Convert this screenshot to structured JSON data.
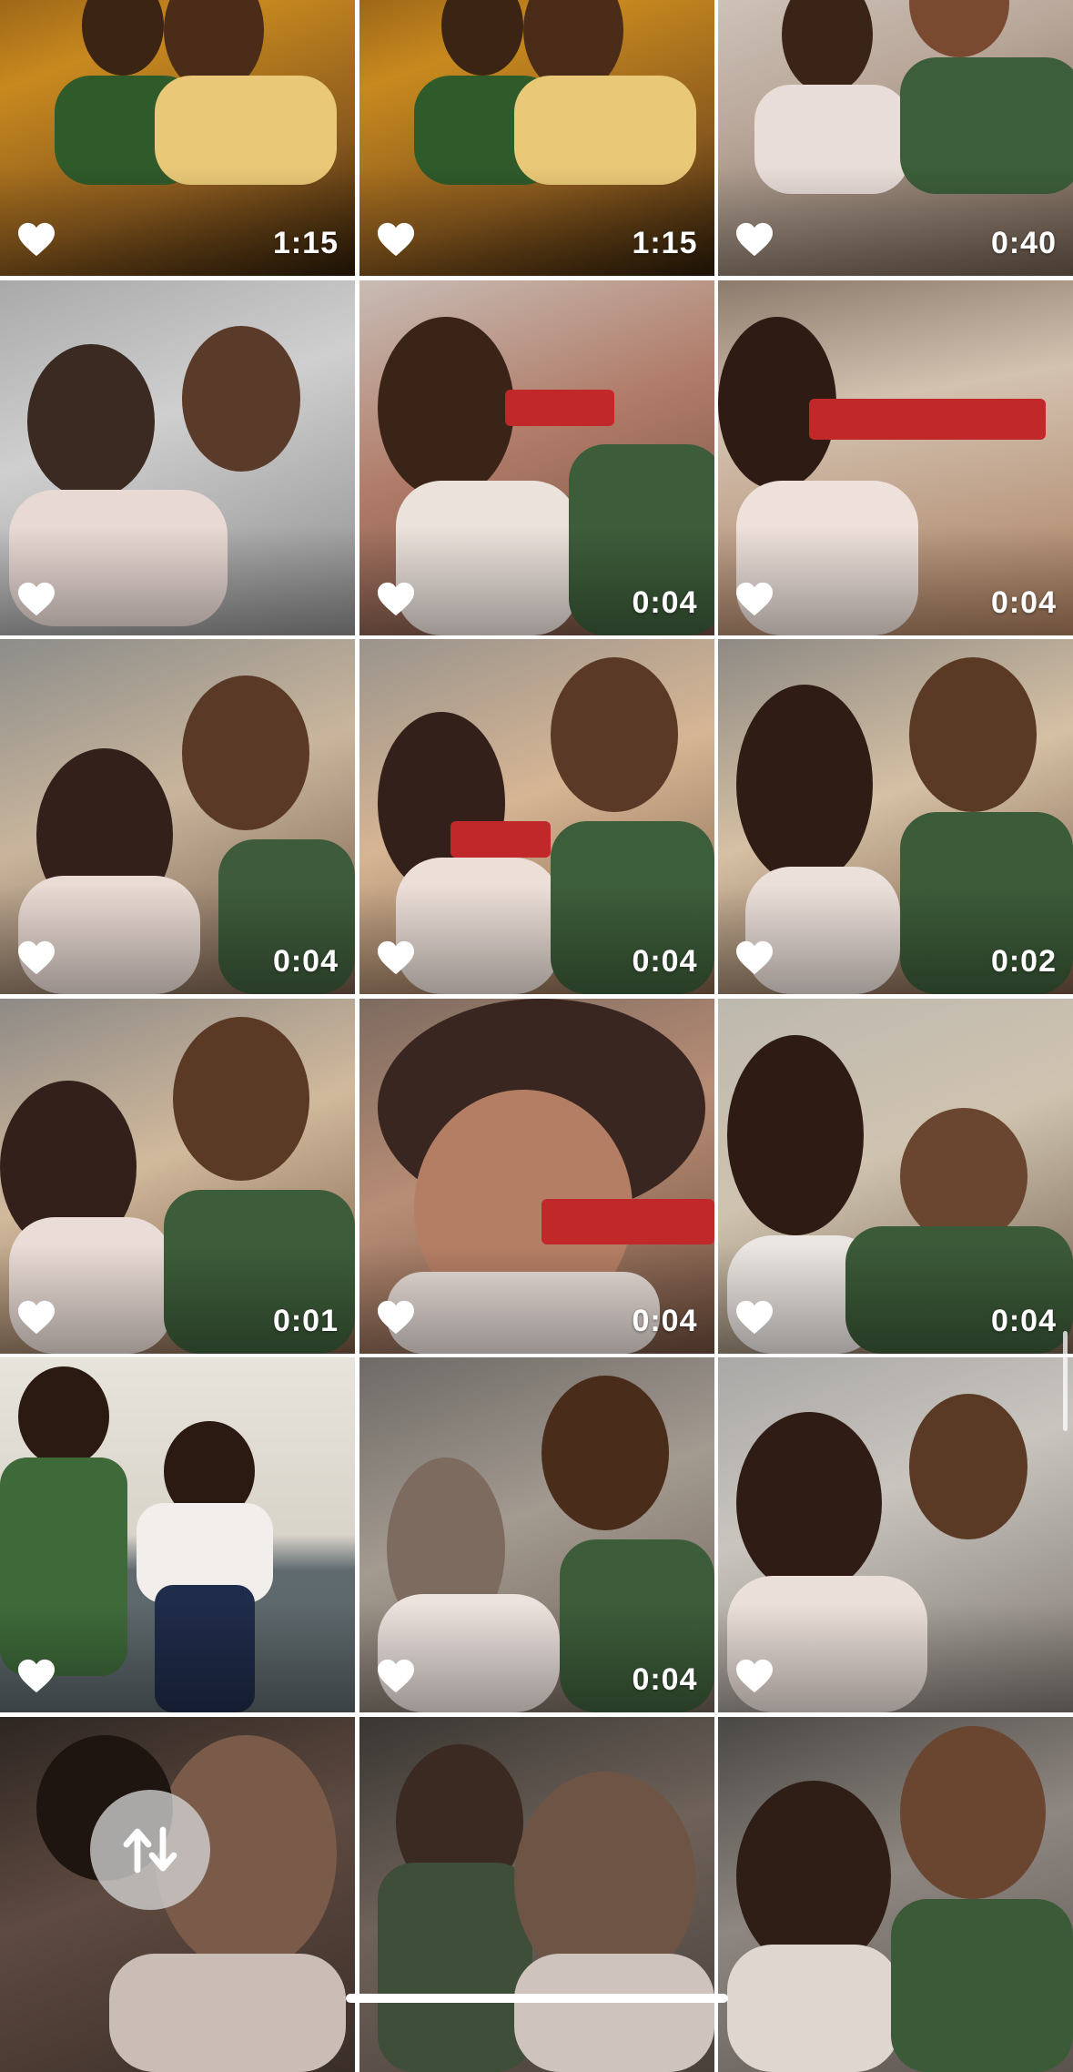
{
  "tiles": [
    {
      "duration": "1:15",
      "favorite": true
    },
    {
      "duration": "1:15",
      "favorite": true
    },
    {
      "duration": "0:40",
      "favorite": true
    },
    {
      "duration": "",
      "favorite": true
    },
    {
      "duration": "0:04",
      "favorite": true
    },
    {
      "duration": "0:04",
      "favorite": true
    },
    {
      "duration": "0:04",
      "favorite": true
    },
    {
      "duration": "0:04",
      "favorite": true
    },
    {
      "duration": "0:02",
      "favorite": true
    },
    {
      "duration": "0:01",
      "favorite": true
    },
    {
      "duration": "0:04",
      "favorite": true
    },
    {
      "duration": "0:04",
      "favorite": true
    },
    {
      "duration": "",
      "favorite": true
    },
    {
      "duration": "0:04",
      "favorite": true
    },
    {
      "duration": "",
      "favorite": true
    },
    {
      "duration": "",
      "favorite": false
    },
    {
      "duration": "",
      "favorite": false
    },
    {
      "duration": "",
      "favorite": false
    }
  ],
  "icons": {
    "favorite": "heart-icon",
    "sort": "sort-arrows-icon"
  },
  "colors": {
    "heart": "#ffffff",
    "duration_text": "#ffffff",
    "sort_button_bg": "#d2d2d2"
  }
}
